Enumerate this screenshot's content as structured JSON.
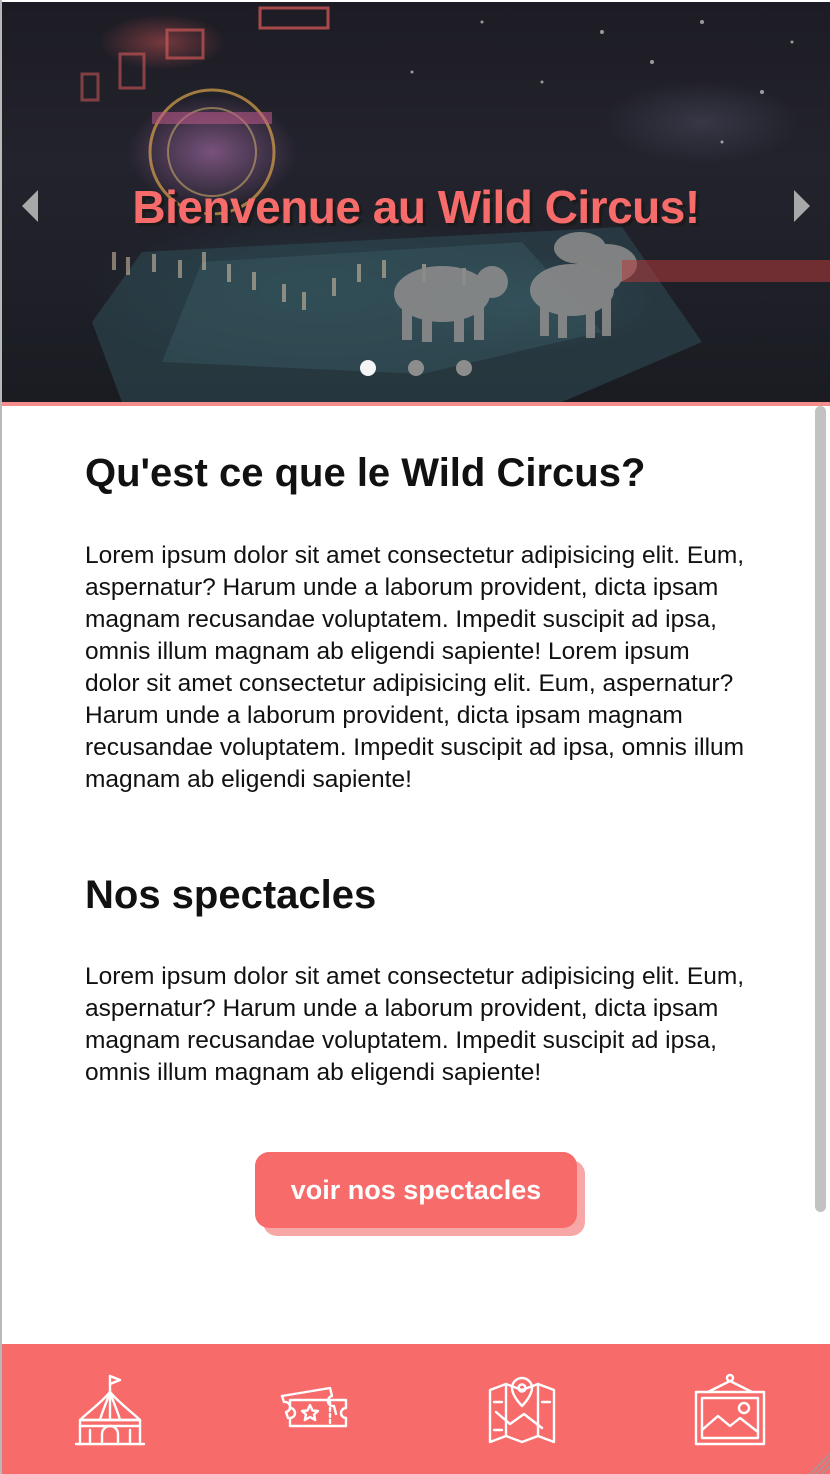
{
  "hero": {
    "title": "Bienvenue au Wild Circus!",
    "slide_count": 3,
    "active_slide": 1
  },
  "sections": [
    {
      "heading": "Qu'est ce que le Wild Circus?",
      "body": "Lorem ipsum dolor sit amet consectetur adipisicing elit. Eum, aspernatur? Harum unde a laborum provident, dicta ipsam magnam recusandae voluptatem. Impedit suscipit ad ipsa, omnis illum magnam ab eligendi sapiente! Lorem ipsum dolor sit amet consectetur adipisicing elit. Eum, aspernatur? Harum unde a laborum provident, dicta ipsam magnam recusandae voluptatem. Impedit suscipit ad ipsa, omnis illum magnam ab eligendi sapiente!"
    },
    {
      "heading": "Nos spectacles",
      "body": "Lorem ipsum dolor sit amet consectetur adipisicing elit. Eum, aspernatur? Harum unde a laborum provident, dicta ipsam magnam recusandae voluptatem. Impedit suscipit ad ipsa, omnis illum magnam ab eligendi sapiente!"
    }
  ],
  "cta": {
    "label": "voir nos spectacles"
  },
  "bottom_nav": {
    "items": [
      {
        "icon": "circus-tent-icon"
      },
      {
        "icon": "ticket-icon"
      },
      {
        "icon": "map-icon"
      },
      {
        "icon": "gallery-frame-icon"
      }
    ]
  },
  "colors": {
    "accent": "#f76b6b",
    "accent_light": "#f8a7a7",
    "text": "#111111",
    "hero_bg": "#1f1f27"
  }
}
